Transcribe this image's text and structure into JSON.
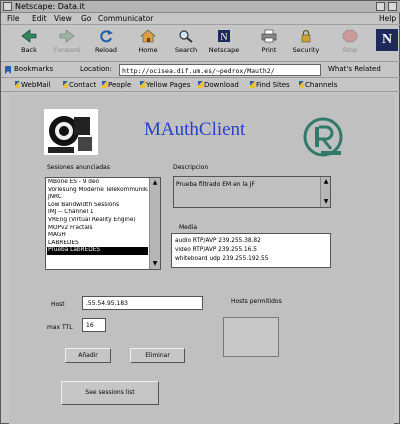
{
  "window": {
    "title": "Netscape: Data.it"
  },
  "menu": {
    "file": "File",
    "edit": "Edit",
    "view": "View",
    "go": "Go",
    "communicator": "Communicator",
    "help": "Help"
  },
  "toolbar": [
    {
      "label": "Back",
      "icon": "back-arrow-icon",
      "disabled": false
    },
    {
      "label": "Forward",
      "icon": "forward-arrow-icon",
      "disabled": true
    },
    {
      "label": "Reload",
      "icon": "reload-icon",
      "disabled": false
    },
    {
      "label": "Home",
      "icon": "home-icon",
      "disabled": false
    },
    {
      "label": "Search",
      "icon": "search-icon",
      "disabled": false
    },
    {
      "label": "Netscape",
      "icon": "netscape-icon",
      "disabled": false
    },
    {
      "label": "Print",
      "icon": "print-icon",
      "disabled": false
    },
    {
      "label": "Security",
      "icon": "security-icon",
      "disabled": false
    },
    {
      "label": "Stop",
      "icon": "stop-icon",
      "disabled": true
    }
  ],
  "brand_logo": "N",
  "location": {
    "bookmarks_label": "Bookmarks",
    "location_label": "Location:",
    "url": "http://ocisea.dif.um.es/~pedrox/Mauth2/",
    "related_label": "What's Related"
  },
  "personal_toolbar": [
    "WebMail",
    "Contact",
    "People",
    "Yellow Pages",
    "Download",
    "Find Sites",
    "Channels"
  ],
  "app": {
    "title": "MAuthClient",
    "sessions_caption": "Sesiones anunciadas",
    "sessions": [
      "MBone ES - 9 deo",
      "Vorlesung Moderne Telekommunika",
      "JNRC",
      "Low Bandwidth Sessions",
      "IMJ -- Channel 1",
      "VREng (Virtual Reality Engine)",
      "MOPv2 Fractals",
      "MAGH",
      "LABREDES",
      "Prueba LabREDES"
    ],
    "selected_session_index": 9,
    "description_caption": "Descripcion",
    "description_text": "Prueba filtrado EM en la JF",
    "media_caption": "Media",
    "media": [
      "audio RTP/AVP 239.255.38.82",
      "video RTP/AVP 239.255.16.5",
      "whiteboard udp 239.255.192.55"
    ],
    "host_label": "Host",
    "host_value": ".55.54.95.183",
    "maxttl_label": "max TTL",
    "maxttl_value": "16",
    "hosts_allowed_label": "Hosts permitidos",
    "add_button": "Añadir",
    "remove_button": "Eliminar",
    "see_sessions_button": "See sessions list"
  }
}
